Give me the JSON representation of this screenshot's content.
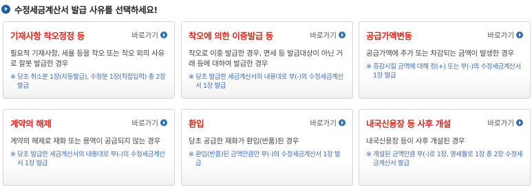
{
  "header": {
    "title": "수정세금계산서 발급 사유를 선택하세요!"
  },
  "shortcut_label": "바로가기",
  "cards": [
    {
      "title": "기재사항 착오정정 등",
      "description": "필요적 기재사항, 세율 등을 착오 또는 착오 외의 사유로 잘못 발급한 경우",
      "note": "※ 당초 취소분 1장(자동발급), 수정분 1장(직접입력) 총 2장 발급"
    },
    {
      "title": "착오에 의한 이중발급 등",
      "description": "착오로 이중 발급한 경우, 면세 등 발급대상이 아닌 거래 등에 대하여 발급한 경우",
      "note": "※ 당초 발급한 세금계산서의 내용대로 부(-)의 수정세금계산서 1장 발급"
    },
    {
      "title": "공급가액변동",
      "description": "공급가액에 추가 또는 차감되는 금액이 발생한 경우",
      "note": "※ 증감시킬 금액에 대해 정(+) 또는 부(-)의 수정세금계산서 1장 발급"
    },
    {
      "title": "계약의 해제",
      "description": "계약의 해제로 재화 또는 용역이 공급되지 않는 경우",
      "note": "※ 당초 발급한 세금계산서의 내용대로 부(-)의 수정세금계산서 1장 발급"
    },
    {
      "title": "환입",
      "description": "당초 공급한 재화가 환입(반품)된 경우",
      "note": "※ 환입(반품)된 금액만큼만 부(-)의 수정세금계산서 1장 발급"
    },
    {
      "title": "내국신용장 등 사후 개설",
      "description": "내국신용장 등이 사후 개설된 경우",
      "note": "※ 개설된 금액만큼 부(-)로 1장, 영세율로 1장 총 2장 수정세금계산서 발급"
    }
  ]
}
